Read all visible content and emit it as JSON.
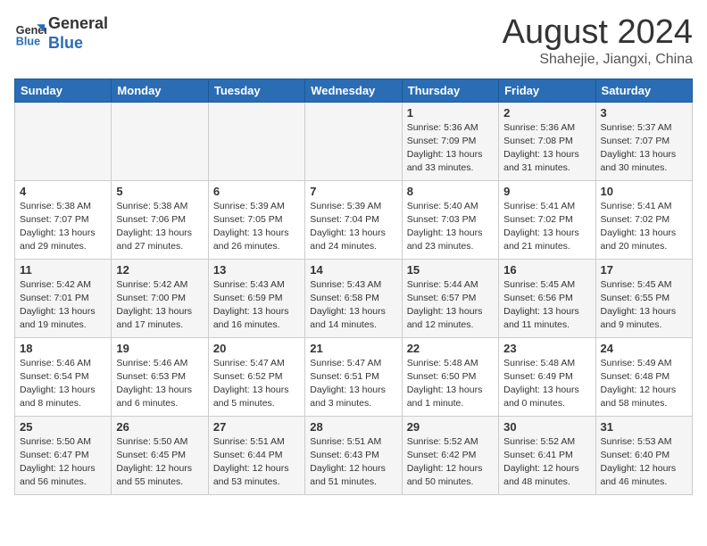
{
  "header": {
    "logo": {
      "general": "General",
      "blue": "Blue"
    },
    "month_year": "August 2024",
    "location": "Shahejie, Jiangxi, China"
  },
  "days_of_week": [
    "Sunday",
    "Monday",
    "Tuesday",
    "Wednesday",
    "Thursday",
    "Friday",
    "Saturday"
  ],
  "weeks": [
    [
      {
        "day": "",
        "info": ""
      },
      {
        "day": "",
        "info": ""
      },
      {
        "day": "",
        "info": ""
      },
      {
        "day": "",
        "info": ""
      },
      {
        "day": "1",
        "info": "Sunrise: 5:36 AM\nSunset: 7:09 PM\nDaylight: 13 hours\nand 33 minutes."
      },
      {
        "day": "2",
        "info": "Sunrise: 5:36 AM\nSunset: 7:08 PM\nDaylight: 13 hours\nand 31 minutes."
      },
      {
        "day": "3",
        "info": "Sunrise: 5:37 AM\nSunset: 7:07 PM\nDaylight: 13 hours\nand 30 minutes."
      }
    ],
    [
      {
        "day": "4",
        "info": "Sunrise: 5:38 AM\nSunset: 7:07 PM\nDaylight: 13 hours\nand 29 minutes."
      },
      {
        "day": "5",
        "info": "Sunrise: 5:38 AM\nSunset: 7:06 PM\nDaylight: 13 hours\nand 27 minutes."
      },
      {
        "day": "6",
        "info": "Sunrise: 5:39 AM\nSunset: 7:05 PM\nDaylight: 13 hours\nand 26 minutes."
      },
      {
        "day": "7",
        "info": "Sunrise: 5:39 AM\nSunset: 7:04 PM\nDaylight: 13 hours\nand 24 minutes."
      },
      {
        "day": "8",
        "info": "Sunrise: 5:40 AM\nSunset: 7:03 PM\nDaylight: 13 hours\nand 23 minutes."
      },
      {
        "day": "9",
        "info": "Sunrise: 5:41 AM\nSunset: 7:02 PM\nDaylight: 13 hours\nand 21 minutes."
      },
      {
        "day": "10",
        "info": "Sunrise: 5:41 AM\nSunset: 7:02 PM\nDaylight: 13 hours\nand 20 minutes."
      }
    ],
    [
      {
        "day": "11",
        "info": "Sunrise: 5:42 AM\nSunset: 7:01 PM\nDaylight: 13 hours\nand 19 minutes."
      },
      {
        "day": "12",
        "info": "Sunrise: 5:42 AM\nSunset: 7:00 PM\nDaylight: 13 hours\nand 17 minutes."
      },
      {
        "day": "13",
        "info": "Sunrise: 5:43 AM\nSunset: 6:59 PM\nDaylight: 13 hours\nand 16 minutes."
      },
      {
        "day": "14",
        "info": "Sunrise: 5:43 AM\nSunset: 6:58 PM\nDaylight: 13 hours\nand 14 minutes."
      },
      {
        "day": "15",
        "info": "Sunrise: 5:44 AM\nSunset: 6:57 PM\nDaylight: 13 hours\nand 12 minutes."
      },
      {
        "day": "16",
        "info": "Sunrise: 5:45 AM\nSunset: 6:56 PM\nDaylight: 13 hours\nand 11 minutes."
      },
      {
        "day": "17",
        "info": "Sunrise: 5:45 AM\nSunset: 6:55 PM\nDaylight: 13 hours\nand 9 minutes."
      }
    ],
    [
      {
        "day": "18",
        "info": "Sunrise: 5:46 AM\nSunset: 6:54 PM\nDaylight: 13 hours\nand 8 minutes."
      },
      {
        "day": "19",
        "info": "Sunrise: 5:46 AM\nSunset: 6:53 PM\nDaylight: 13 hours\nand 6 minutes."
      },
      {
        "day": "20",
        "info": "Sunrise: 5:47 AM\nSunset: 6:52 PM\nDaylight: 13 hours\nand 5 minutes."
      },
      {
        "day": "21",
        "info": "Sunrise: 5:47 AM\nSunset: 6:51 PM\nDaylight: 13 hours\nand 3 minutes."
      },
      {
        "day": "22",
        "info": "Sunrise: 5:48 AM\nSunset: 6:50 PM\nDaylight: 13 hours\nand 1 minute."
      },
      {
        "day": "23",
        "info": "Sunrise: 5:48 AM\nSunset: 6:49 PM\nDaylight: 13 hours\nand 0 minutes."
      },
      {
        "day": "24",
        "info": "Sunrise: 5:49 AM\nSunset: 6:48 PM\nDaylight: 12 hours\nand 58 minutes."
      }
    ],
    [
      {
        "day": "25",
        "info": "Sunrise: 5:50 AM\nSunset: 6:47 PM\nDaylight: 12 hours\nand 56 minutes."
      },
      {
        "day": "26",
        "info": "Sunrise: 5:50 AM\nSunset: 6:45 PM\nDaylight: 12 hours\nand 55 minutes."
      },
      {
        "day": "27",
        "info": "Sunrise: 5:51 AM\nSunset: 6:44 PM\nDaylight: 12 hours\nand 53 minutes."
      },
      {
        "day": "28",
        "info": "Sunrise: 5:51 AM\nSunset: 6:43 PM\nDaylight: 12 hours\nand 51 minutes."
      },
      {
        "day": "29",
        "info": "Sunrise: 5:52 AM\nSunset: 6:42 PM\nDaylight: 12 hours\nand 50 minutes."
      },
      {
        "day": "30",
        "info": "Sunrise: 5:52 AM\nSunset: 6:41 PM\nDaylight: 12 hours\nand 48 minutes."
      },
      {
        "day": "31",
        "info": "Sunrise: 5:53 AM\nSunset: 6:40 PM\nDaylight: 12 hours\nand 46 minutes."
      }
    ]
  ]
}
